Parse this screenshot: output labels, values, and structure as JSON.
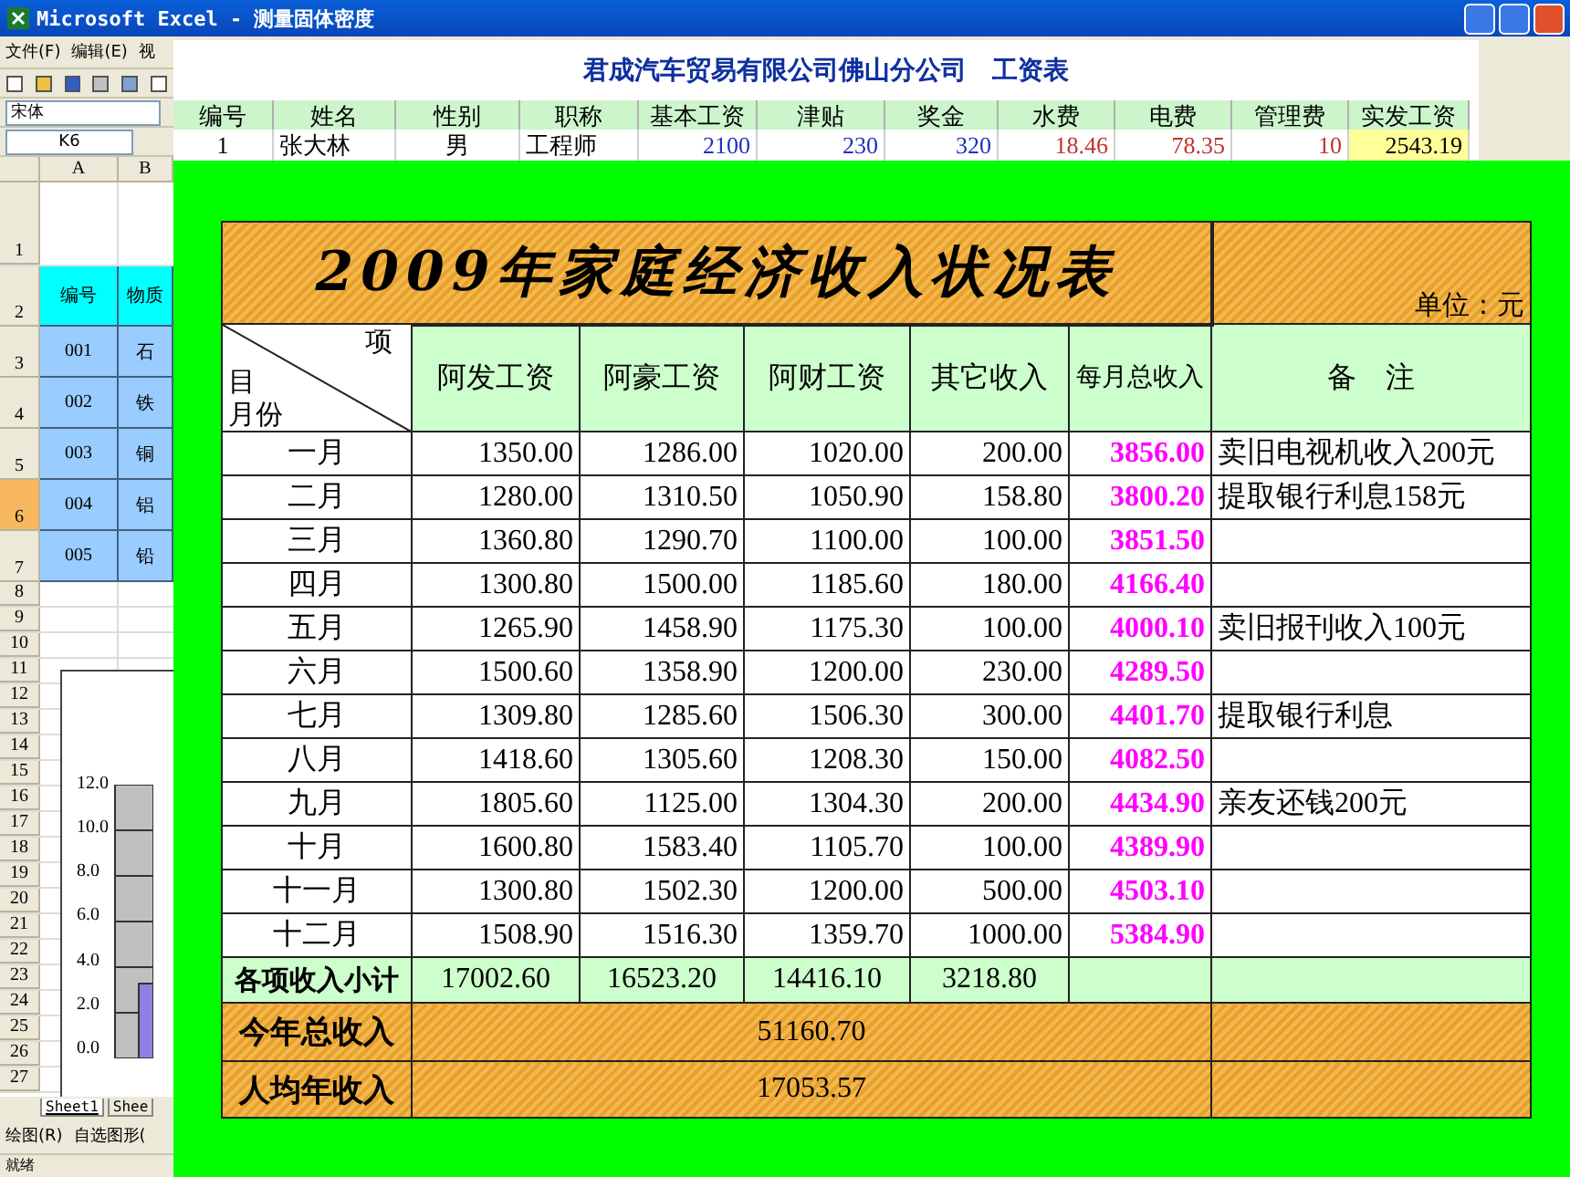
{
  "excel": {
    "title": "Microsoft Excel - 测量固体密度",
    "menu": [
      "文件(F)",
      "编辑(E)",
      "视"
    ],
    "font_box": "宋体",
    "name_box": "K6",
    "columns": [
      "A",
      "B"
    ],
    "row_headers": [
      {
        "label": "1",
        "selected": false
      },
      {
        "label": "2",
        "selected": false
      },
      {
        "label": "3",
        "selected": false
      },
      {
        "label": "4",
        "selected": false
      },
      {
        "label": "5",
        "selected": false
      },
      {
        "label": "6",
        "selected": true
      },
      {
        "label": "7",
        "selected": false
      },
      {
        "label": "8",
        "selected": false
      },
      {
        "label": "9",
        "selected": false
      },
      {
        "label": "10",
        "selected": false
      },
      {
        "label": "11",
        "selected": false
      },
      {
        "label": "12",
        "selected": false
      },
      {
        "label": "13",
        "selected": false
      },
      {
        "label": "14",
        "selected": false
      },
      {
        "label": "15",
        "selected": false
      },
      {
        "label": "16",
        "selected": false
      },
      {
        "label": "17",
        "selected": false
      },
      {
        "label": "18",
        "selected": false
      },
      {
        "label": "19",
        "selected": false
      },
      {
        "label": "20",
        "selected": false
      },
      {
        "label": "21",
        "selected": false
      },
      {
        "label": "22",
        "selected": false
      },
      {
        "label": "23",
        "selected": false
      },
      {
        "label": "24",
        "selected": false
      },
      {
        "label": "25",
        "selected": false
      },
      {
        "label": "26",
        "selected": false
      },
      {
        "label": "27",
        "selected": false
      }
    ],
    "header_cells": [
      "编号",
      "物质"
    ],
    "data_cells": [
      [
        "001",
        "石"
      ],
      [
        "002",
        "铁"
      ],
      [
        "003",
        "铜"
      ],
      [
        "004",
        "铝"
      ],
      [
        "005",
        "铅"
      ]
    ],
    "chart_ticks": [
      "12.0",
      "10.0",
      "8.0",
      "6.0",
      "4.0",
      "2.0",
      "0.0"
    ],
    "sheet_tabs": [
      {
        "label": "Sheet1",
        "selected": true
      },
      {
        "label": "Shee",
        "selected": false
      }
    ],
    "drawing_toolbar": [
      "绘图(R)",
      "自选图形("
    ],
    "status": "就绪"
  },
  "salary": {
    "title": "君成汽车贸易有限公司佛山分公司　工资表",
    "columns": [
      "编号",
      "姓名",
      "性别",
      "职称",
      "基本工资",
      "津贴",
      "奖金",
      "水费",
      "电费",
      "管理费",
      "实发工资"
    ],
    "rows": [
      [
        {
          "text": "1",
          "kind": "center"
        },
        {
          "text": "张大林",
          "kind": "left"
        },
        {
          "text": "男",
          "kind": "center"
        },
        {
          "text": "工程师",
          "kind": "left"
        },
        {
          "text": "2100",
          "kind": "income"
        },
        {
          "text": "230",
          "kind": "income"
        },
        {
          "text": "320",
          "kind": "income"
        },
        {
          "text": "18.46",
          "kind": "deduction"
        },
        {
          "text": "78.35",
          "kind": "deduction"
        },
        {
          "text": "10",
          "kind": "deduction"
        },
        {
          "text": "2543.19",
          "kind": "total"
        }
      ]
    ]
  },
  "income": {
    "title": "2009年家庭经济收入状况表",
    "unit": "单位：元",
    "corner": {
      "top": "项",
      "middle": "目",
      "bottom": "月份"
    },
    "columns": [
      "阿发工资",
      "阿豪工资",
      "阿财工资",
      "其它收入",
      "每月总收入"
    ],
    "note_header": "备　注",
    "rows": [
      {
        "month": "一月",
        "values": [
          "1350.00",
          "1286.00",
          "1020.00",
          "200.00"
        ],
        "total": "3856.00",
        "note": "卖旧电视机收入200元"
      },
      {
        "month": "二月",
        "values": [
          "1280.00",
          "1310.50",
          "1050.90",
          "158.80"
        ],
        "total": "3800.20",
        "note": "提取银行利息158元"
      },
      {
        "month": "三月",
        "values": [
          "1360.80",
          "1290.70",
          "1100.00",
          "100.00"
        ],
        "total": "3851.50"
      },
      {
        "month": "四月",
        "values": [
          "1300.80",
          "1500.00",
          "1185.60",
          "180.00"
        ],
        "total": "4166.40"
      },
      {
        "month": "五月",
        "values": [
          "1265.90",
          "1458.90",
          "1175.30",
          "100.00"
        ],
        "total": "4000.10",
        "note": "卖旧报刊收入100元"
      },
      {
        "month": "六月",
        "values": [
          "1500.60",
          "1358.90",
          "1200.00",
          "230.00"
        ],
        "total": "4289.50"
      },
      {
        "month": "七月",
        "values": [
          "1309.80",
          "1285.60",
          "1506.30",
          "300.00"
        ],
        "total": "4401.70",
        "note": "提取银行利息"
      },
      {
        "month": "八月",
        "values": [
          "1418.60",
          "1305.60",
          "1208.30",
          "150.00"
        ],
        "total": "4082.50"
      },
      {
        "month": "九月",
        "values": [
          "1805.60",
          "1125.00",
          "1304.30",
          "200.00"
        ],
        "total": "4434.90",
        "note": "亲友还钱200元"
      },
      {
        "month": "十月",
        "values": [
          "1600.80",
          "1583.40",
          "1105.70",
          "100.00"
        ],
        "total": "4389.90"
      },
      {
        "month": "十一月",
        "values": [
          "1300.80",
          "1502.30",
          "1200.00",
          "500.00"
        ],
        "total": "4503.10"
      },
      {
        "month": "十二月",
        "values": [
          "1508.90",
          "1516.30",
          "1359.70",
          "1000.00"
        ],
        "total": "5384.90"
      }
    ],
    "subtotal": {
      "label": "各项收入小计",
      "values": [
        "17002.60",
        "16523.20",
        "14416.10",
        "3218.80"
      ]
    },
    "summary": [
      {
        "label": "今年总收入",
        "value": "51160.70"
      },
      {
        "label": "人均年收入",
        "value": "17053.57"
      }
    ]
  }
}
